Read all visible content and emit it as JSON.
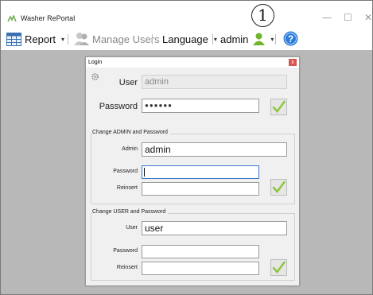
{
  "window": {
    "title": "Washer RePortal",
    "minimize": "—",
    "maximize": "☐",
    "close": "✕"
  },
  "toolbar": {
    "report": "Report",
    "manage_users": "Manage Users",
    "language": "Language",
    "user": "admin",
    "dropdown_caret": "▾"
  },
  "callout": {
    "number": "1"
  },
  "login": {
    "title": "Login",
    "close": "x",
    "user_label": "User",
    "user_value": "admin",
    "password_label": "Password",
    "password_value": "●●●●●●"
  },
  "admin_section": {
    "title": "Change ADMIN and Password",
    "admin_label": "Admin",
    "admin_value": "admin",
    "password_label": "Password",
    "password_value": "",
    "reinsert_label": "Reinsert",
    "reinsert_value": ""
  },
  "user_section": {
    "title": "Change USER and Password",
    "user_label": "User",
    "user_value": "user",
    "password_label": "Password",
    "password_value": "",
    "reinsert_label": "Reinsert",
    "reinsert_value": ""
  },
  "colors": {
    "check_green": "#8cc63f",
    "help_blue": "#2b7bd9",
    "workspace": "#b8b8b8"
  }
}
